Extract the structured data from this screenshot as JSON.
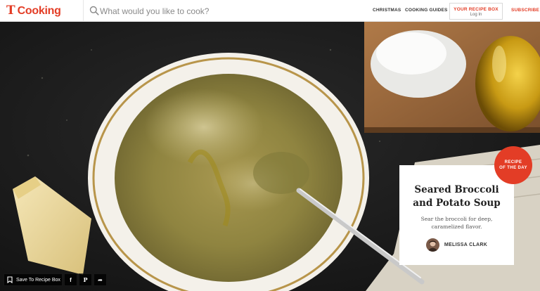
{
  "header": {
    "logo_mark": "T",
    "logo_text": "Cooking",
    "search_placeholder": "What would you like to cook?",
    "nav": {
      "christmas": "CHRISTMAS",
      "cooking_guides": "COOKING GUIDES",
      "recipe_box": "YOUR RECIPE BOX",
      "login": "Log In",
      "subscribe": "SUBSCRIBE"
    }
  },
  "feature": {
    "badge_line1": "RECIPE",
    "badge_line2": "OF THE DAY",
    "title": "Seared Broccoli and Potato Soup",
    "description": "Sear the broccoli for deep, caramelized flavor.",
    "author": "MELISSA CLARK"
  },
  "actions": {
    "save_label": "Save To Recipe Box",
    "facebook_glyph": "f",
    "pinterest_glyph": "P",
    "share_glyph": "➦"
  },
  "icons": [
    "search-icon",
    "bookmark-icon",
    "facebook-icon",
    "pinterest-icon",
    "share-icon"
  ],
  "colors": {
    "brand": "#e33d26",
    "background": "#1a1a1a",
    "card": "#ffffff"
  }
}
